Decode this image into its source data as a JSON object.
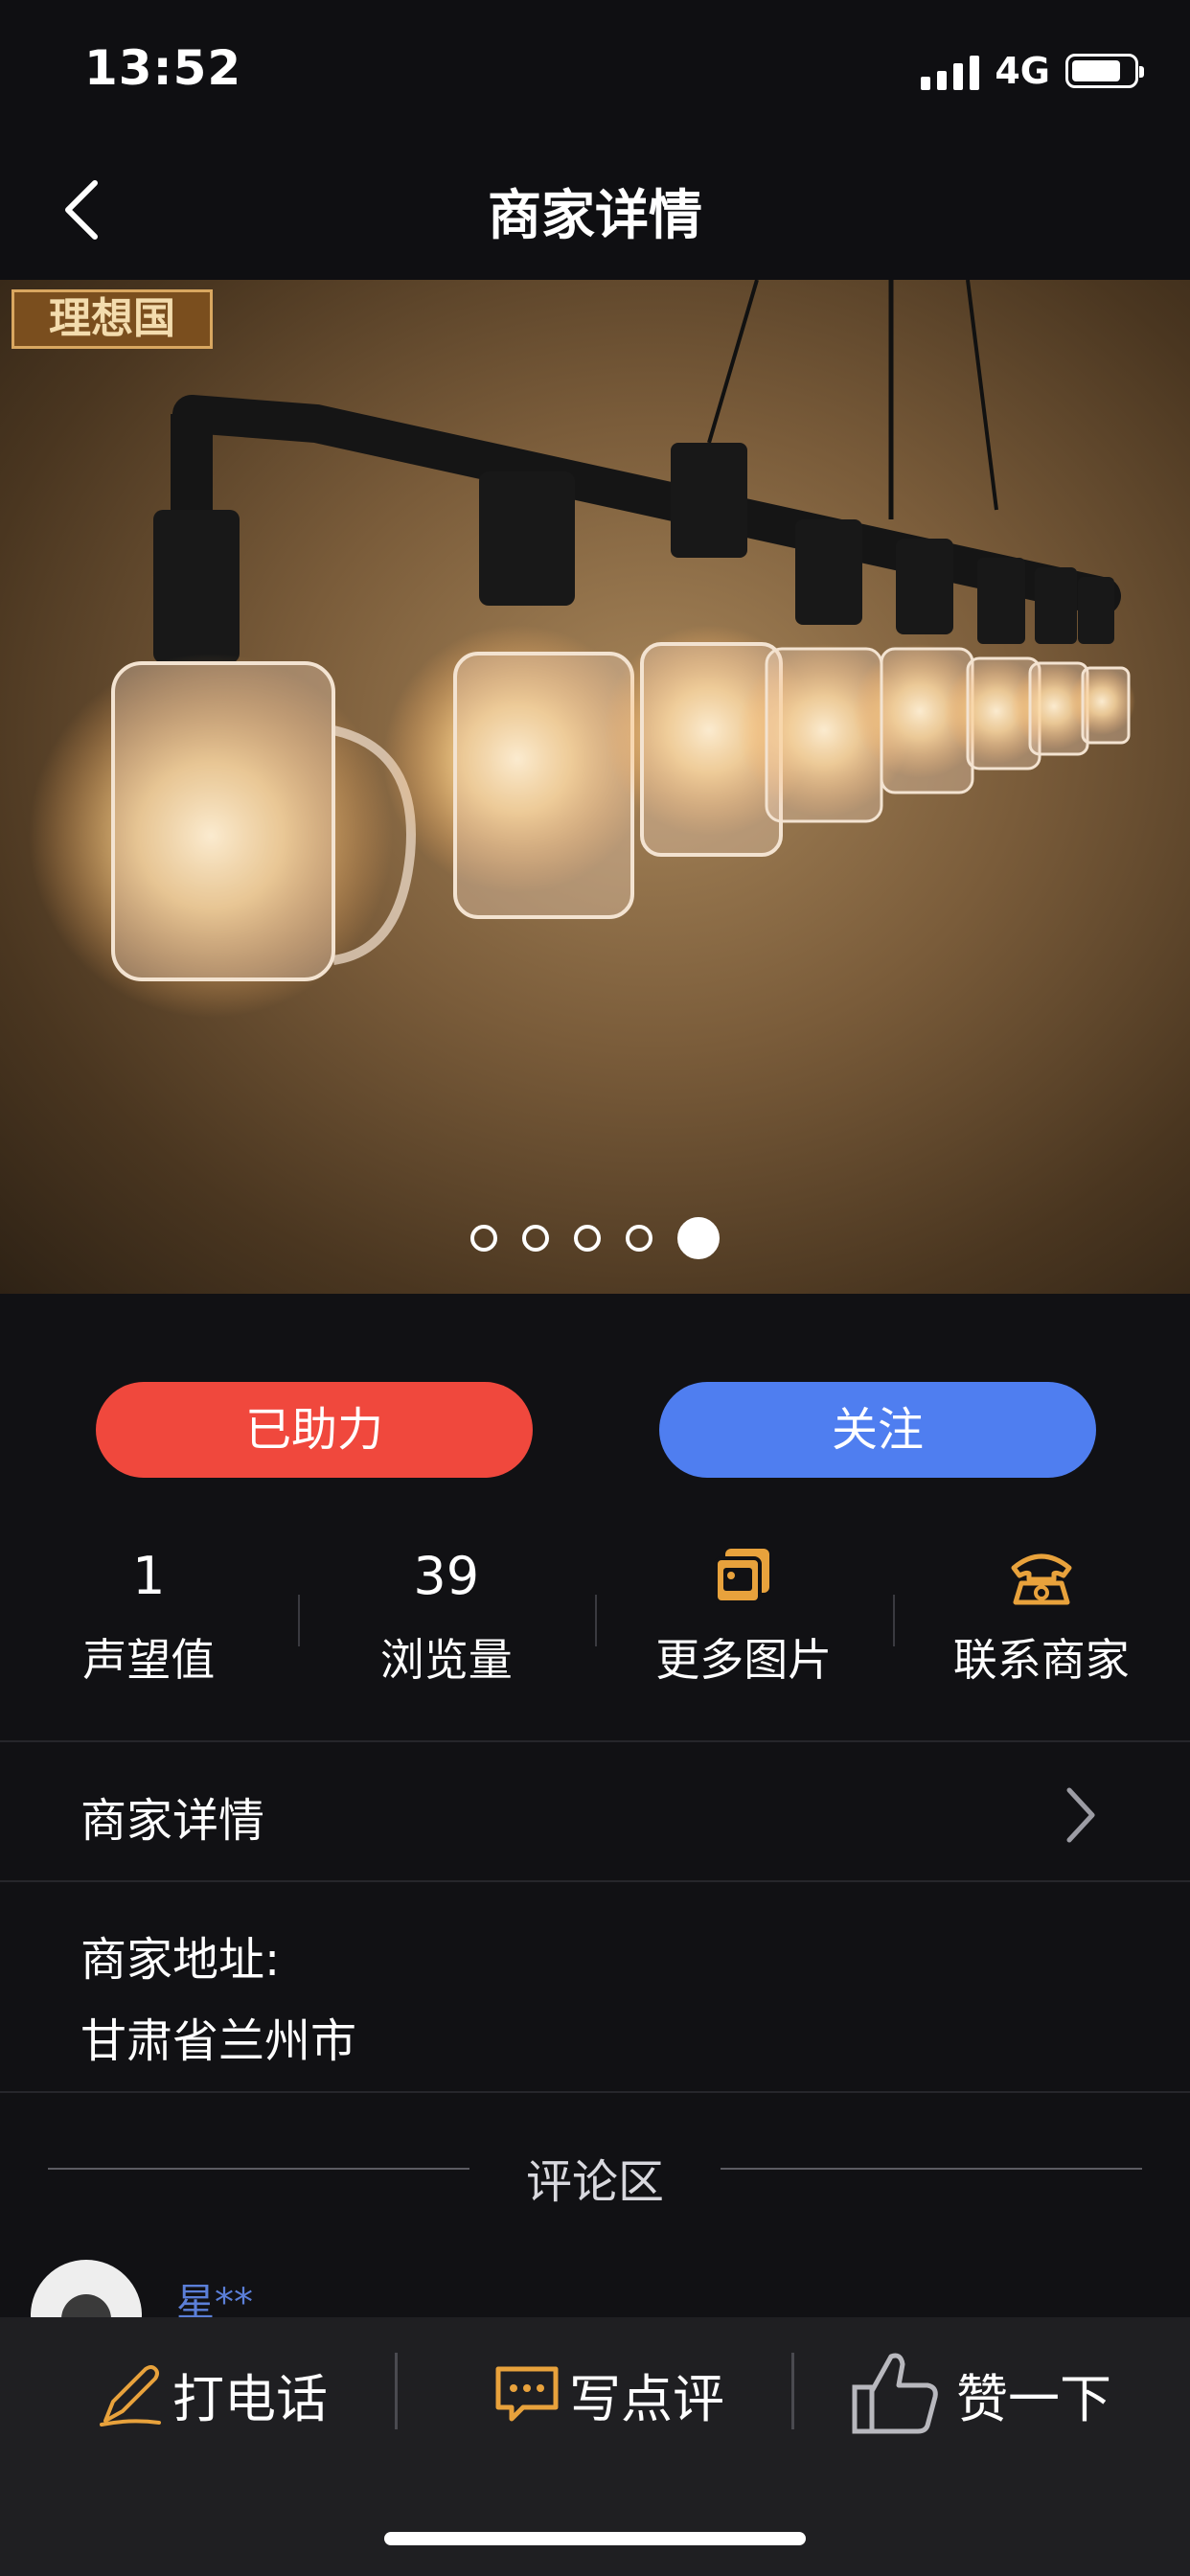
{
  "status_bar": {
    "time": "13:52",
    "network": "4G",
    "battery_level": 0.8
  },
  "nav": {
    "title": "商家详情",
    "back_icon": "chevron-left-icon"
  },
  "hero": {
    "brand_logo_text": "理想国",
    "dots_count": 5,
    "active_dot": 5
  },
  "actions": {
    "help_label": "已助力",
    "follow_label": "关注",
    "help_color": "#f0483d",
    "follow_color": "#4f7ef0"
  },
  "stats": [
    {
      "value": "1",
      "label": "声望值"
    },
    {
      "value": "39",
      "label": "浏览量"
    },
    {
      "icon": "gallery-icon",
      "label": "更多图片"
    },
    {
      "icon": "phone-icon",
      "label": "联系商家"
    }
  ],
  "detail_row": {
    "label": "商家详情"
  },
  "address": {
    "label": "商家地址:",
    "value": "甘肃省兰州市"
  },
  "comments": {
    "title": "评论区",
    "first_user": "星**"
  },
  "bottom_bar": {
    "call": "打电话",
    "review": "写点评",
    "like": "赞一下",
    "accent": "#e8a23c"
  }
}
